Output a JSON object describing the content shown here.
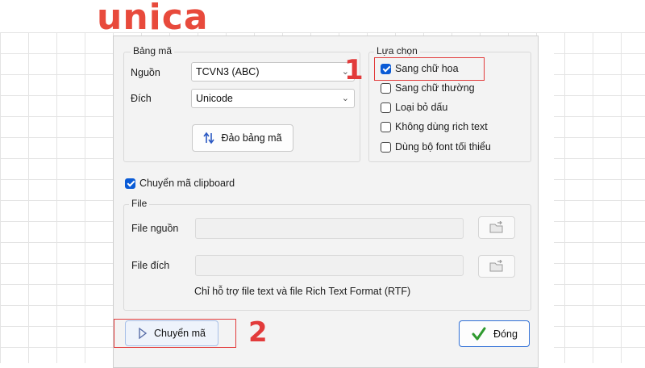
{
  "brand": {
    "logo_text": "unica",
    "color": "#e84a3c"
  },
  "accent_color": "#0a5bd6",
  "callout_color": "#e23b3b",
  "bang_ma": {
    "title": "Bảng mã",
    "source_label": "Nguồn",
    "source_value": "TCVN3 (ABC)",
    "dest_label": "Đích",
    "dest_value": "Unicode",
    "swap_button": "Đảo bảng mã"
  },
  "options": {
    "title": "Lựa chọn",
    "items": [
      {
        "label": "Sang chữ hoa",
        "checked": true
      },
      {
        "label": "Sang chữ thường",
        "checked": false
      },
      {
        "label": "Loại bỏ dấu",
        "checked": false
      },
      {
        "label": "Không dùng rich text",
        "checked": false
      },
      {
        "label": "Dùng bộ font tối thiểu",
        "checked": false
      }
    ]
  },
  "clipboard": {
    "label": "Chuyển mã clipboard",
    "checked": true
  },
  "file": {
    "title": "File",
    "source_label": "File nguồn",
    "source_value": "",
    "dest_label": "File đích",
    "dest_value": "",
    "note": "Chỉ hỗ trợ file text và file Rich Text Format (RTF)"
  },
  "footer": {
    "convert_button": "Chuyển mã",
    "close_button": "Đóng"
  },
  "annotations": {
    "step1": "1",
    "step2": "2"
  }
}
